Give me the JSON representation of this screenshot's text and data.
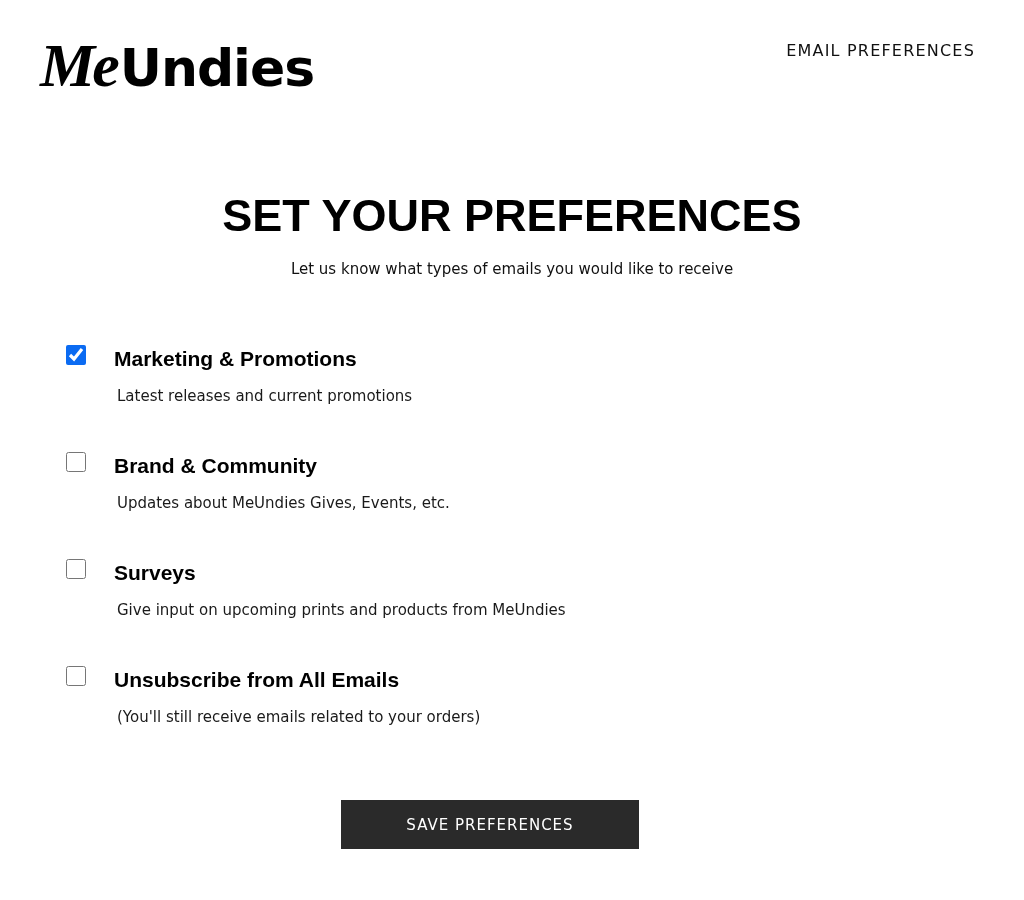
{
  "header": {
    "logo": {
      "script": "Me",
      "wordmark": "Undies"
    },
    "nav_link": "EMAIL PREFERENCES"
  },
  "intro": {
    "title": "SET YOUR PREFERENCES",
    "subtitle": "Let us know what types of emails you would like to receive"
  },
  "options": [
    {
      "label": "Marketing & Promotions",
      "description": "Latest releases and current promotions",
      "checked": true
    },
    {
      "label": "Brand & Community",
      "description": "Updates about MeUndies Gives, Events, etc.",
      "checked": false
    },
    {
      "label": "Surveys",
      "description": "Give input on upcoming prints and products from MeUndies",
      "checked": false
    },
    {
      "label": "Unsubscribe from All Emails",
      "description": "(You'll still receive emails related to your orders)",
      "checked": false
    }
  ],
  "save_button": {
    "label": "SAVE PREFERENCES"
  }
}
